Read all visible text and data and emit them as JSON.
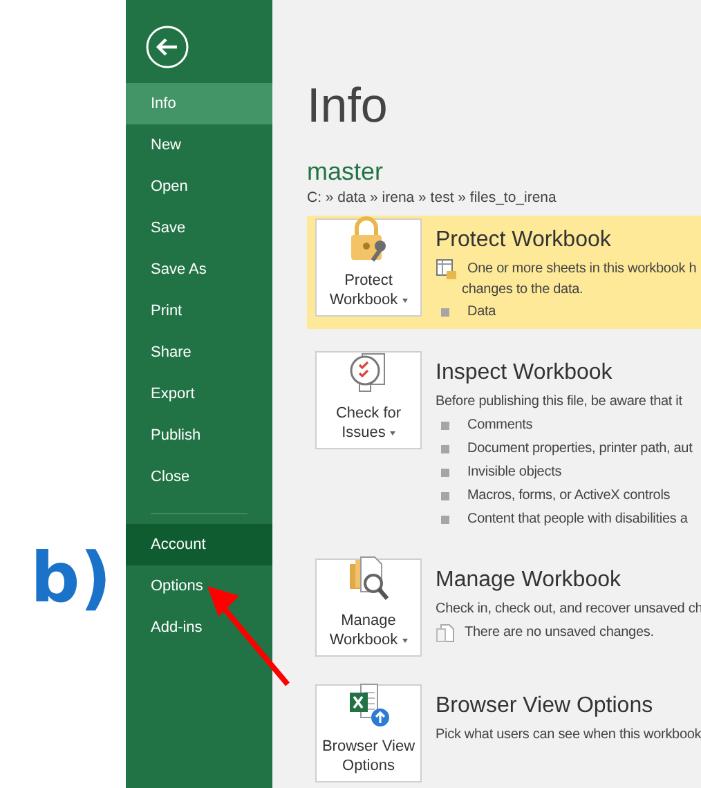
{
  "annotation": {
    "label": "b)"
  },
  "sidebar": {
    "items": [
      {
        "label": "Info",
        "selected": true,
        "hovered": false,
        "divider_before": false
      },
      {
        "label": "New",
        "selected": false,
        "hovered": false,
        "divider_before": false
      },
      {
        "label": "Open",
        "selected": false,
        "hovered": false,
        "divider_before": false
      },
      {
        "label": "Save",
        "selected": false,
        "hovered": false,
        "divider_before": false
      },
      {
        "label": "Save As",
        "selected": false,
        "hovered": false,
        "divider_before": false
      },
      {
        "label": "Print",
        "selected": false,
        "hovered": false,
        "divider_before": false
      },
      {
        "label": "Share",
        "selected": false,
        "hovered": false,
        "divider_before": false
      },
      {
        "label": "Export",
        "selected": false,
        "hovered": false,
        "divider_before": false
      },
      {
        "label": "Publish",
        "selected": false,
        "hovered": false,
        "divider_before": false
      },
      {
        "label": "Close",
        "selected": false,
        "hovered": false,
        "divider_before": false
      },
      {
        "label": "Account",
        "selected": false,
        "hovered": true,
        "divider_before": true
      },
      {
        "label": "Options",
        "selected": false,
        "hovered": false,
        "divider_before": false
      },
      {
        "label": "Add-ins",
        "selected": false,
        "hovered": false,
        "divider_before": false
      }
    ]
  },
  "page": {
    "title": "Info",
    "file_name": "master",
    "path": "C: » data » irena » test » files_to_irena"
  },
  "sections": [
    {
      "kind": "protect",
      "button": "Protect Workbook",
      "dropdown": true,
      "highlighted": true,
      "title": "Protect Workbook",
      "lines": [
        {
          "kind": "icon",
          "text": "One or more sheets in this workbook h"
        },
        {
          "kind": "continued",
          "text": "changes to the data."
        },
        {
          "kind": "bullet",
          "text": "Data"
        }
      ]
    },
    {
      "kind": "inspect",
      "button": "Check for Issues",
      "dropdown": true,
      "highlighted": false,
      "title": "Inspect Workbook",
      "lines": [
        {
          "kind": "text",
          "text": "Before publishing this file, be aware that it"
        },
        {
          "kind": "bullet",
          "text": "Comments"
        },
        {
          "kind": "bullet",
          "text": "Document properties, printer path, aut"
        },
        {
          "kind": "bullet",
          "text": "Invisible objects"
        },
        {
          "kind": "bullet",
          "text": "Macros, forms, or ActiveX controls"
        },
        {
          "kind": "bullet",
          "text": "Content that people with disabilities a"
        }
      ]
    },
    {
      "kind": "manage",
      "button": "Manage Workbook",
      "dropdown": true,
      "highlighted": false,
      "title": "Manage Workbook",
      "lines": [
        {
          "kind": "text",
          "text": "Check in, check out, and recover unsaved ch"
        },
        {
          "kind": "icon",
          "text": "There are no unsaved changes."
        }
      ]
    },
    {
      "kind": "browser-view",
      "button": "Browser View Options",
      "dropdown": false,
      "highlighted": false,
      "title": "Browser View Options",
      "lines": [
        {
          "kind": "text",
          "text": "Pick what users can see when this workbook"
        }
      ]
    }
  ]
}
